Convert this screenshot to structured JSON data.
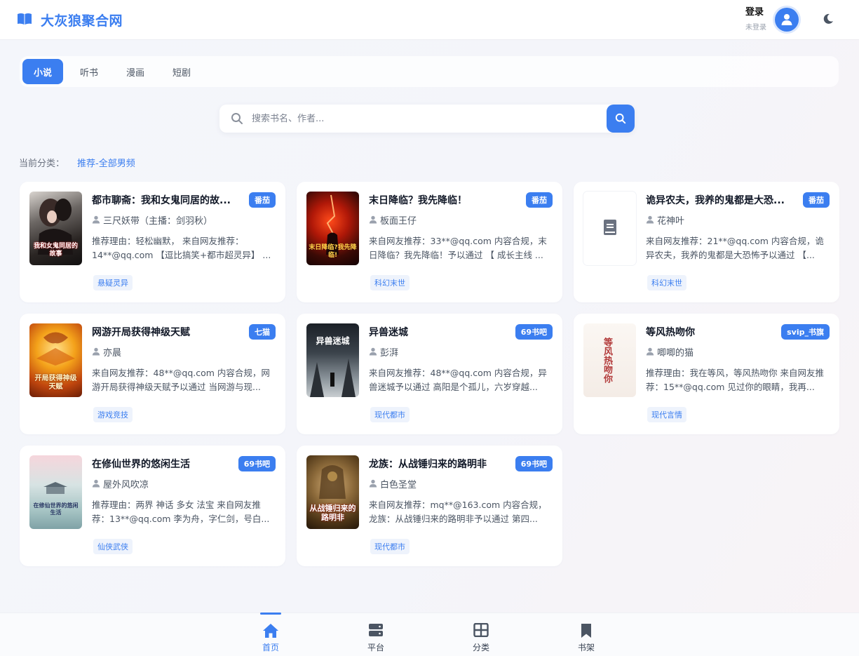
{
  "app": {
    "title": "大灰狼聚合网"
  },
  "header": {
    "login_title": "登录",
    "login_sub": "未登录",
    "avatar_icon": "user-avatar-icon",
    "theme_icon": "moon-icon"
  },
  "tabs": [
    {
      "label": "小说",
      "active": true
    },
    {
      "label": "听书",
      "active": false
    },
    {
      "label": "漫画",
      "active": false
    },
    {
      "label": "短剧",
      "active": false
    }
  ],
  "search": {
    "placeholder": "搜索书名、作者..."
  },
  "category": {
    "prefix": "当前分类：",
    "value": "推荐-全部男频"
  },
  "colors": {
    "accent": "#3b7ef0",
    "tag_bg": "#eef3fc"
  },
  "books": [
    {
      "title": "都市聊斋：我和女鬼同居的故...",
      "badge": "番茄",
      "author": "三尺妖带（主播：剑羽秋）",
      "desc": "推荐理由：轻松幽默， 来自网友推荐：14**@qq.com 【逗比搞笑+都市超灵异】 ...",
      "tag": "悬疑灵异",
      "cover_text": "我和女鬼同居的故事"
    },
    {
      "title": "末日降临？我先降临！",
      "badge": "番茄",
      "author": "板面王仔",
      "desc": "来自网友推荐：33**@qq.com 内容合规，末日降临？我先降临！予以通过 【 成长主线 ...",
      "tag": "科幻末世",
      "cover_text": "末日降临?我先降临!"
    },
    {
      "title": "诡异农夫，我养的鬼都是大恐...",
      "badge": "番茄",
      "author": "花神叶",
      "desc": "来自网友推荐：21**@qq.com 内容合规，诡异农夫，我养的鬼都是大恐怖予以通过 【...",
      "tag": "科幻末世",
      "cover_text": ""
    },
    {
      "title": "网游开局获得神级天赋",
      "badge": "七猫",
      "author": "亦晨",
      "desc": "来自网友推荐：48**@qq.com 内容合规，网游开局获得神级天赋予以通过 当网游与现...",
      "tag": "游戏竞技",
      "cover_text": "开局获得神级天赋"
    },
    {
      "title": "异兽迷城",
      "badge": "69书吧",
      "author": "彭湃",
      "desc": "来自网友推荐：48**@qq.com 内容合规，异兽迷城予以通过 高阳是个孤儿，六岁穿越...",
      "tag": "现代都市",
      "cover_text": "异兽迷城"
    },
    {
      "title": "等风热吻你",
      "badge": "svip_书旗",
      "author": "唧唧的猫",
      "desc": "推荐理由：我在等风，等风热吻你 来自网友推荐：15**@qq.com 见过你的眼睛，我再...",
      "tag": "现代言情",
      "cover_text": "等风热吻你"
    },
    {
      "title": "在修仙世界的悠闲生活",
      "badge": "69书吧",
      "author": "屋外风吹凉",
      "desc": "推荐理由：两界 神话 多女 法宝 来自网友推荐：13**@qq.com 李为舟，字仁剑，号白...",
      "tag": "仙侠武侠",
      "cover_text": "在修仙世界的悠闲生活"
    },
    {
      "title": "龙族：从战锤归来的路明非",
      "badge": "69书吧",
      "author": "白色圣堂",
      "desc": "来自网友推荐：mq**@163.com 内容合规，龙族：从战锤归来的路明非予以通过 第四...",
      "tag": "现代都市",
      "cover_text": "从战锤归来的路明非"
    }
  ],
  "bottom_nav": [
    {
      "label": "首页",
      "icon": "home-icon",
      "active": true
    },
    {
      "label": "平台",
      "icon": "server-icon",
      "active": false
    },
    {
      "label": "分类",
      "icon": "grid-icon",
      "active": false
    },
    {
      "label": "书架",
      "icon": "bookmark-icon",
      "active": false
    }
  ]
}
